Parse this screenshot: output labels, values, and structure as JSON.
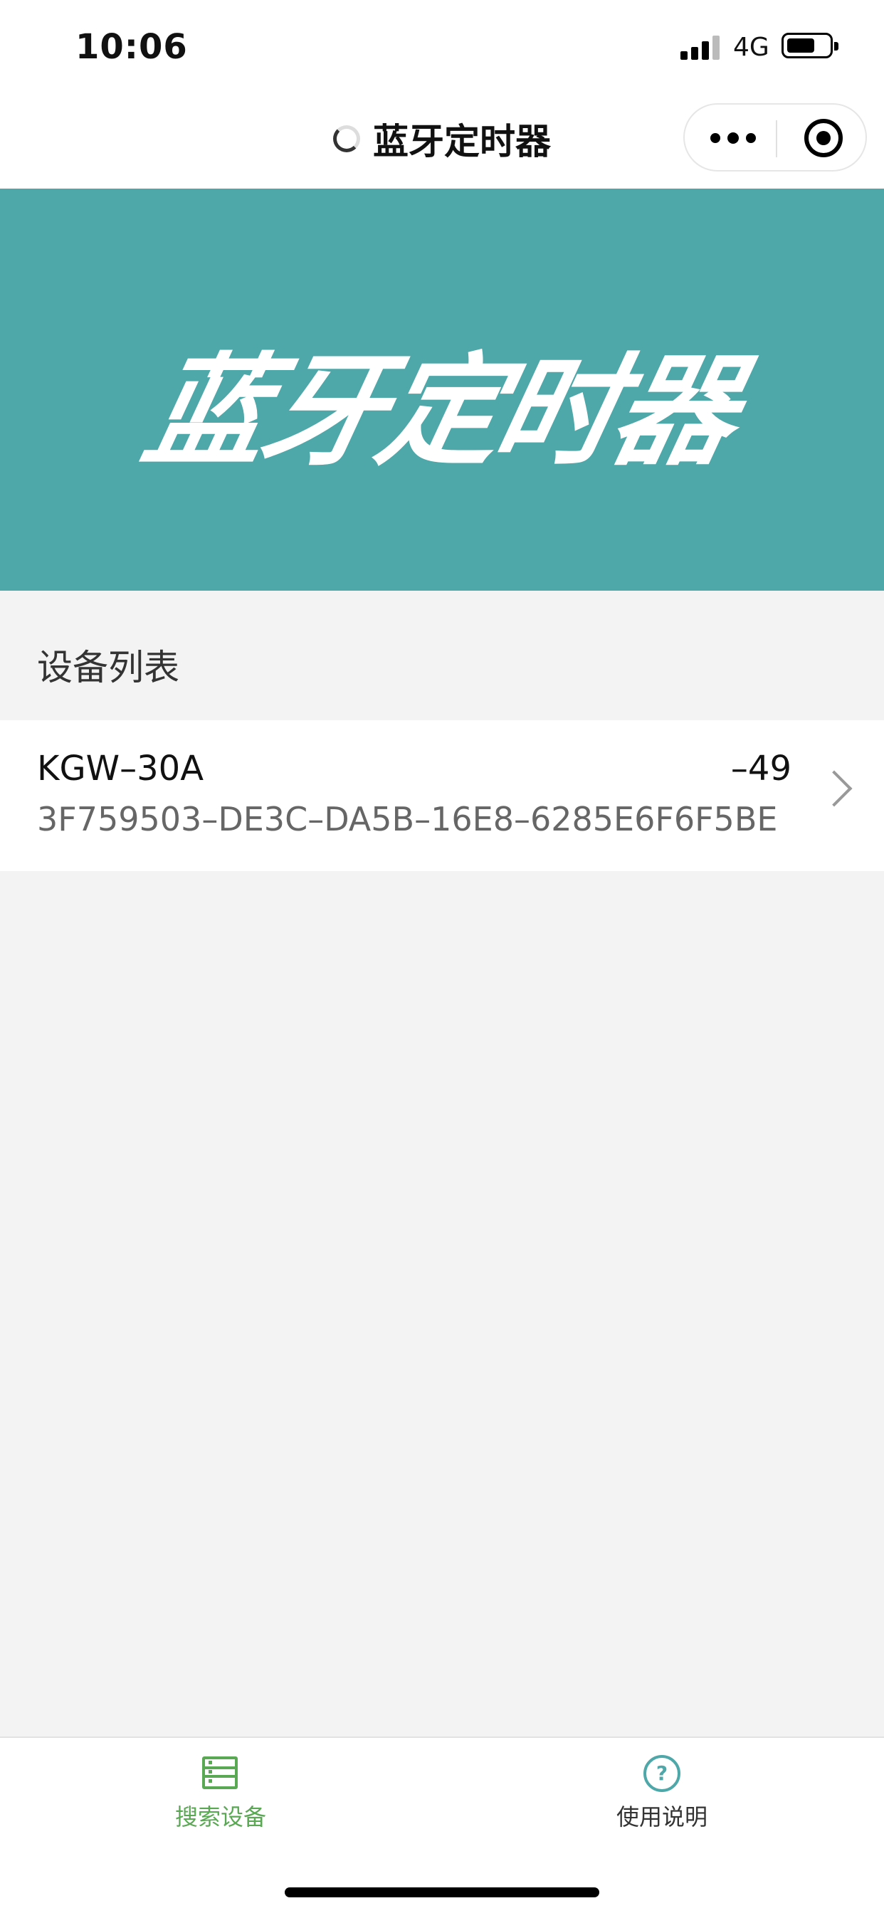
{
  "status_bar": {
    "time": "10:06",
    "network": "4G",
    "signal_icon": "signal-bars-icon",
    "battery_icon": "battery-icon"
  },
  "nav": {
    "title": "蓝牙定时器",
    "loading_icon": "spinner-icon",
    "more_icon": "more-dots-icon",
    "close_icon": "target-close-icon"
  },
  "banner": {
    "text": "蓝牙定时器",
    "background_color": "#4ea7a8"
  },
  "section": {
    "title": "设备列表"
  },
  "devices": [
    {
      "name": "KGW–30A",
      "rssi": "–49",
      "uuid": "3F759503–DE3C–DA5B–16E8–6285E6F6F5BE"
    }
  ],
  "tab_bar": {
    "tabs": [
      {
        "label": "搜索设备",
        "icon": "device-list-icon",
        "active": true
      },
      {
        "label": "使用说明",
        "icon": "help-circle-icon",
        "active": false
      }
    ],
    "active_color": "#5aa854"
  }
}
